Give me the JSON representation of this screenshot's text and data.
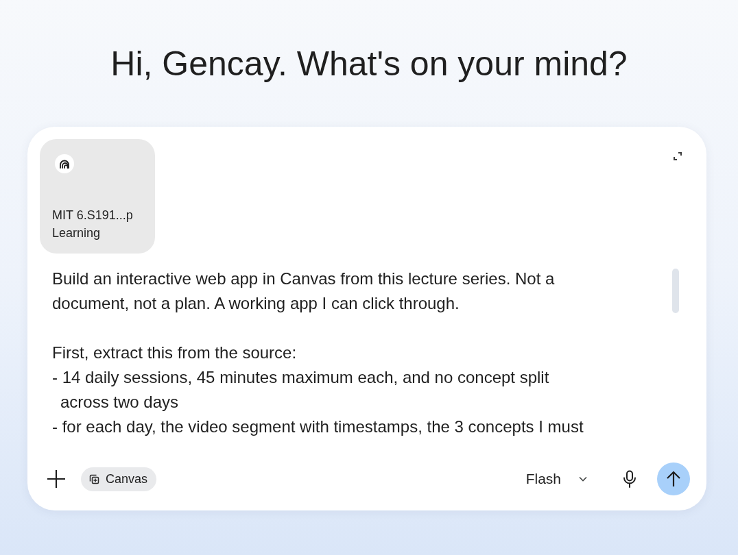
{
  "greeting": "Hi, Gencay. What's on your mind?",
  "composer": {
    "attachment": {
      "title_lines": [
        "MIT 6.S191...p",
        "Learning"
      ]
    },
    "prompt": {
      "paragraphs": [
        {
          "lines": [
            {
              "kind": "line",
              "text": "Build an interactive web app in Canvas from this lecture series. Not a"
            },
            {
              "kind": "line",
              "text": "document, not a plan. A working app I can click through."
            }
          ]
        },
        {
          "lines": [
            {
              "kind": "line",
              "text": "First, extract this from the source:"
            },
            {
              "kind": "line",
              "text": "- 14 daily sessions, 45 minutes maximum each, and no concept split"
            },
            {
              "kind": "continuation",
              "text": "across two days"
            },
            {
              "kind": "line",
              "text": "- for each day, the video segment with timestamps, the 3 concepts I must"
            }
          ]
        }
      ]
    },
    "tool_chip": {
      "label": "Canvas"
    },
    "model": {
      "label": "Flash"
    }
  }
}
